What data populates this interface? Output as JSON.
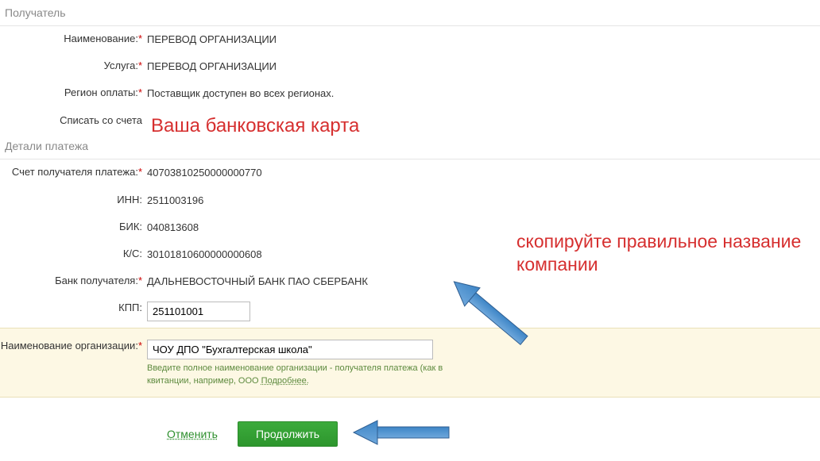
{
  "sections": {
    "recipient": "Получатель",
    "details": "Детали платежа"
  },
  "recipient": {
    "name_label": "Наименование:",
    "name_value": "ПЕРЕВОД ОРГАНИЗАЦИИ",
    "service_label": "Услуга:",
    "service_value": "ПЕРЕВОД ОРГАНИЗАЦИИ",
    "region_label": "Регион оплаты:",
    "region_value": "Поставщик доступен во всех регионах.",
    "debit_label": "Списать со счета"
  },
  "details": {
    "account_label": "Счет получателя платежа:",
    "account_value": "40703810250000000770",
    "inn_label": "ИНН:",
    "inn_value": "2511003196",
    "bik_label": "БИК:",
    "bik_value": "040813608",
    "ks_label": "К/С:",
    "ks_value": "30101810600000000608",
    "bank_label": "Банк получателя:",
    "bank_value": "ДАЛЬНЕВОСТОЧНЫЙ БАНК ПАО СБЕРБАНК",
    "kpp_label": "КПП:",
    "kpp_value": "251101001",
    "org_label": "Наименование организации:",
    "org_value": "ЧОУ ДПО \"Бухгалтерская школа\"",
    "org_hint": "Введите полное наименование организации - получателя платежа (как в квитанции, например, ООО ",
    "org_hint_link": "Подробнее."
  },
  "annotations": {
    "card": "Ваша банковская карта",
    "copy_company": "скопируйте правильное название компании"
  },
  "actions": {
    "cancel": "Отменить",
    "continue": "Продолжить"
  }
}
